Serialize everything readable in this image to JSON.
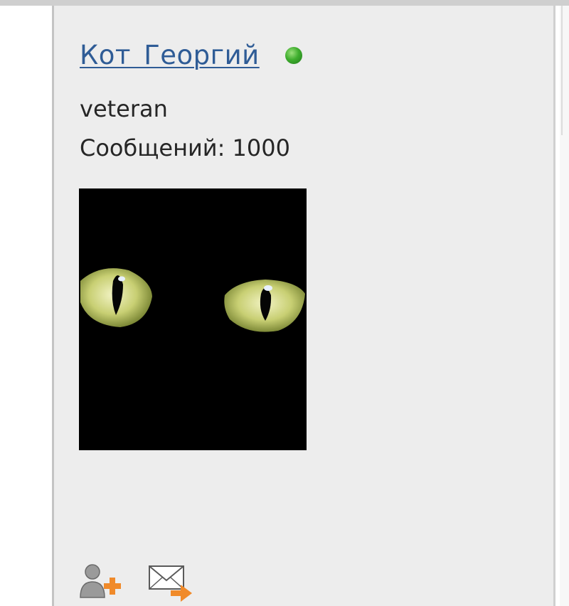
{
  "profile": {
    "username": "Кот Георгий",
    "status": "online",
    "rank": "veteran",
    "posts_label": "Сообщений:",
    "posts_count": "1000",
    "posts_text": "Сообщений: 1000",
    "avatar": "black-cat-eyes",
    "colors": {
      "link": "#2f5c96",
      "online": "#3fae2e",
      "panel_bg": "#ededed",
      "text": "#262626"
    }
  },
  "actions": [
    {
      "icon": "add-friend-icon"
    },
    {
      "icon": "send-message-icon"
    }
  ]
}
